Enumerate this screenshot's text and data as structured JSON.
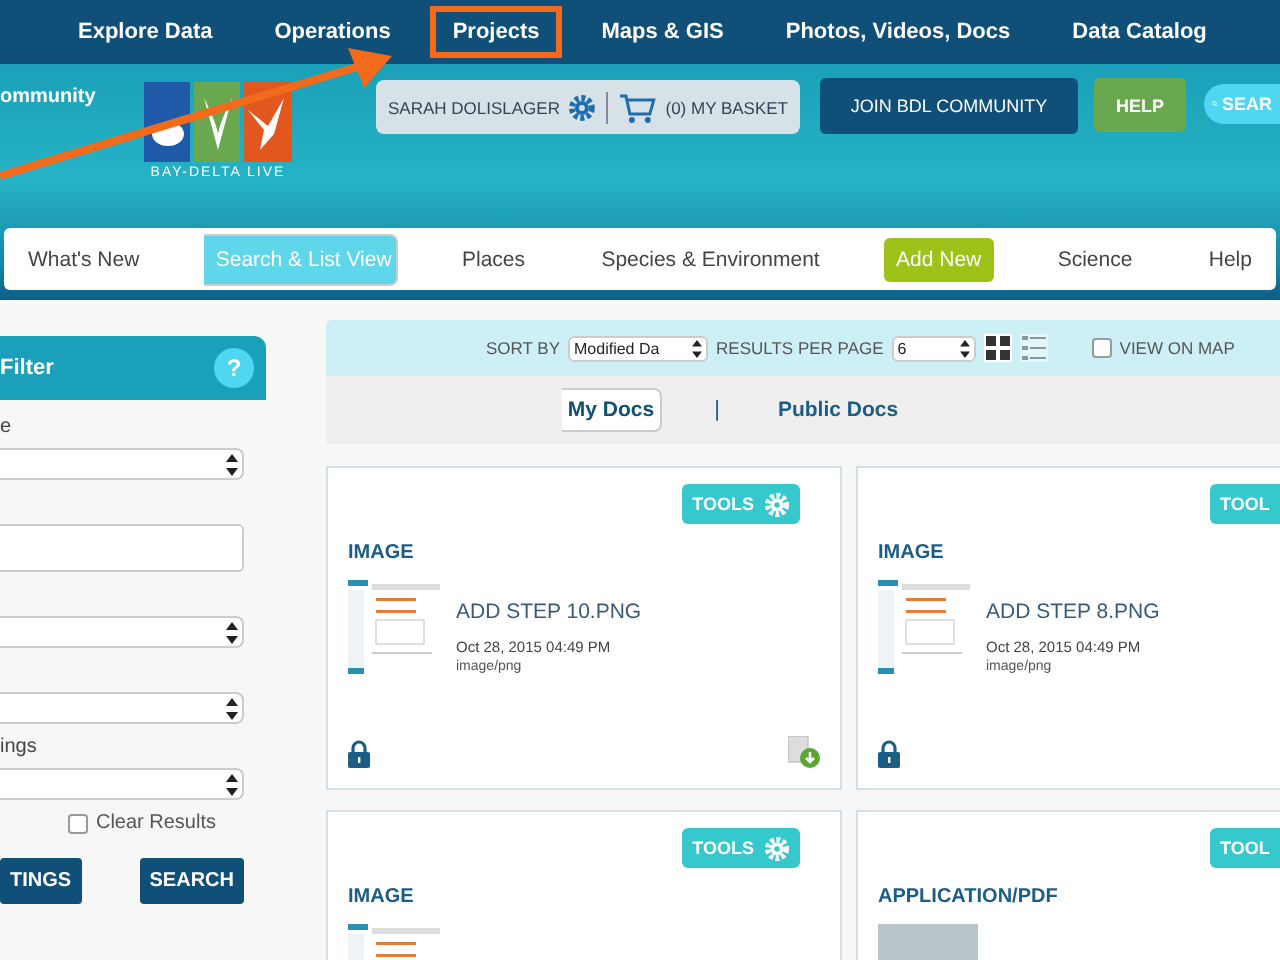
{
  "top_nav": [
    {
      "label": "Explore Data",
      "highlighted": false
    },
    {
      "label": "Operations",
      "highlighted": false
    },
    {
      "label": "Projects",
      "highlighted": true
    },
    {
      "label": "Maps & GIS",
      "highlighted": false
    },
    {
      "label": "Photos, Videos, Docs",
      "highlighted": false
    },
    {
      "label": "Data Catalog",
      "highlighted": false
    }
  ],
  "header": {
    "community_text": "ommunity",
    "logo_text": "BAY-DELTA LIVE",
    "user": "SARAH DOLISLAGER",
    "basket": "(0) MY BASKET",
    "join_button": "JOIN BDL COMMUNITY",
    "help_button": "HELP",
    "search_button": "SEAR"
  },
  "sub_nav": [
    {
      "label": "What's New",
      "kind": "link",
      "selected": false
    },
    {
      "label": "Search & List View",
      "kind": "link",
      "selected": true
    },
    {
      "label": "Places",
      "kind": "link",
      "selected": false
    },
    {
      "label": "Species & Environment",
      "kind": "link",
      "selected": false
    },
    {
      "label": "Add New",
      "kind": "action",
      "selected": false
    },
    {
      "label": "Science",
      "kind": "link",
      "selected": false
    },
    {
      "label": "Help",
      "kind": "link",
      "selected": false
    }
  ],
  "filter": {
    "title": "Filter",
    "help": "?",
    "fields": [
      {
        "kind": "select",
        "label": "e"
      },
      {
        "kind": "input"
      },
      {
        "kind": "select"
      },
      {
        "kind": "select"
      },
      {
        "kind": "select",
        "label": "ings"
      }
    ],
    "clear_results": {
      "label": "Clear Results",
      "checked": false
    },
    "buttons": [
      "TINGS",
      "SEARCH"
    ]
  },
  "toolbar": {
    "sort_label": "SORT BY",
    "sort_value": "Modified Da",
    "per_page_label": "RESULTS PER PAGE",
    "per_page_value": "6",
    "grid_view": {
      "selected": true
    },
    "list_view": {
      "selected": false
    },
    "view_on_map": {
      "label": "VIEW ON MAP",
      "checked": false
    }
  },
  "doc_tabs": {
    "separator": "|",
    "tabs": [
      {
        "label": "My Docs",
        "selected": true
      },
      {
        "label": "Public Docs",
        "selected": false
      }
    ]
  },
  "cards": [
    {
      "type": "IMAGE",
      "tools": "TOOLS",
      "thumb": {
        "kind": "screenshot"
      },
      "title": "ADD STEP 10.PNG",
      "date": "Oct 28, 2015 04:49 PM",
      "mime": "image/png",
      "locked": true,
      "downloadable": true
    },
    {
      "type": "IMAGE",
      "tools": "TOOL",
      "thumb": {
        "kind": "screenshot"
      },
      "title": "ADD STEP 8.PNG",
      "date": "Oct 28, 2015 04:49 PM",
      "mime": "image/png",
      "locked": true,
      "downloadable": false
    },
    {
      "type": "IMAGE",
      "tools": "TOOLS",
      "thumb": {
        "kind": "screenshot"
      }
    },
    {
      "type": "APPLICATION/PDF",
      "tools": "TOOL",
      "thumb": {
        "kind": "photo"
      }
    }
  ]
}
